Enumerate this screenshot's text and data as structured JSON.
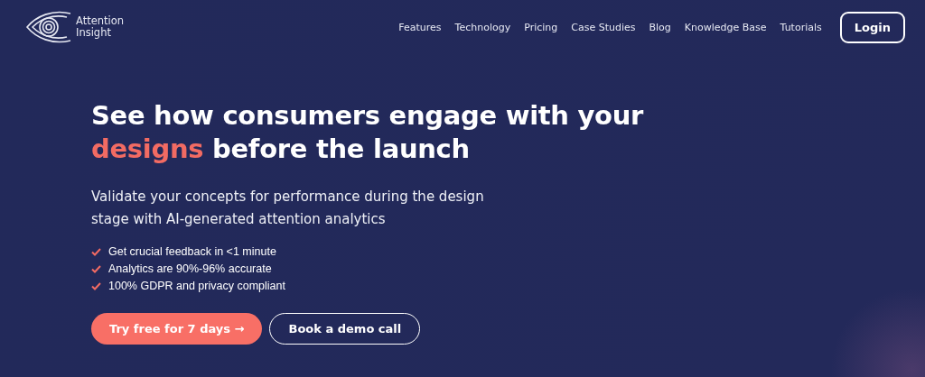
{
  "header": {
    "logo_text": [
      "Attention",
      "Insight"
    ],
    "nav": [
      "Features",
      "Technology",
      "Pricing",
      "Case Studies",
      "Blog",
      "Knowledge Base",
      "Tutorials"
    ],
    "login": "Login"
  },
  "hero": {
    "headline": [
      {
        "text": "See how consumers engage with your",
        "accent": false
      },
      {
        "text": "designs",
        "accent": true
      },
      {
        "text": " before the launch",
        "accent": false
      }
    ],
    "subtitle": "Validate your concepts for performance during the design stage with AI-generated attention analytics",
    "features": [
      "Get crucial feedback in <1 minute",
      "Analytics are 90%-96% accurate",
      "100% GDPR and privacy compliant"
    ],
    "buttons": [
      {
        "label": "Try free for 7 days →",
        "kind": "primary"
      },
      {
        "label": "Book a demo call",
        "kind": "outline"
      }
    ]
  }
}
